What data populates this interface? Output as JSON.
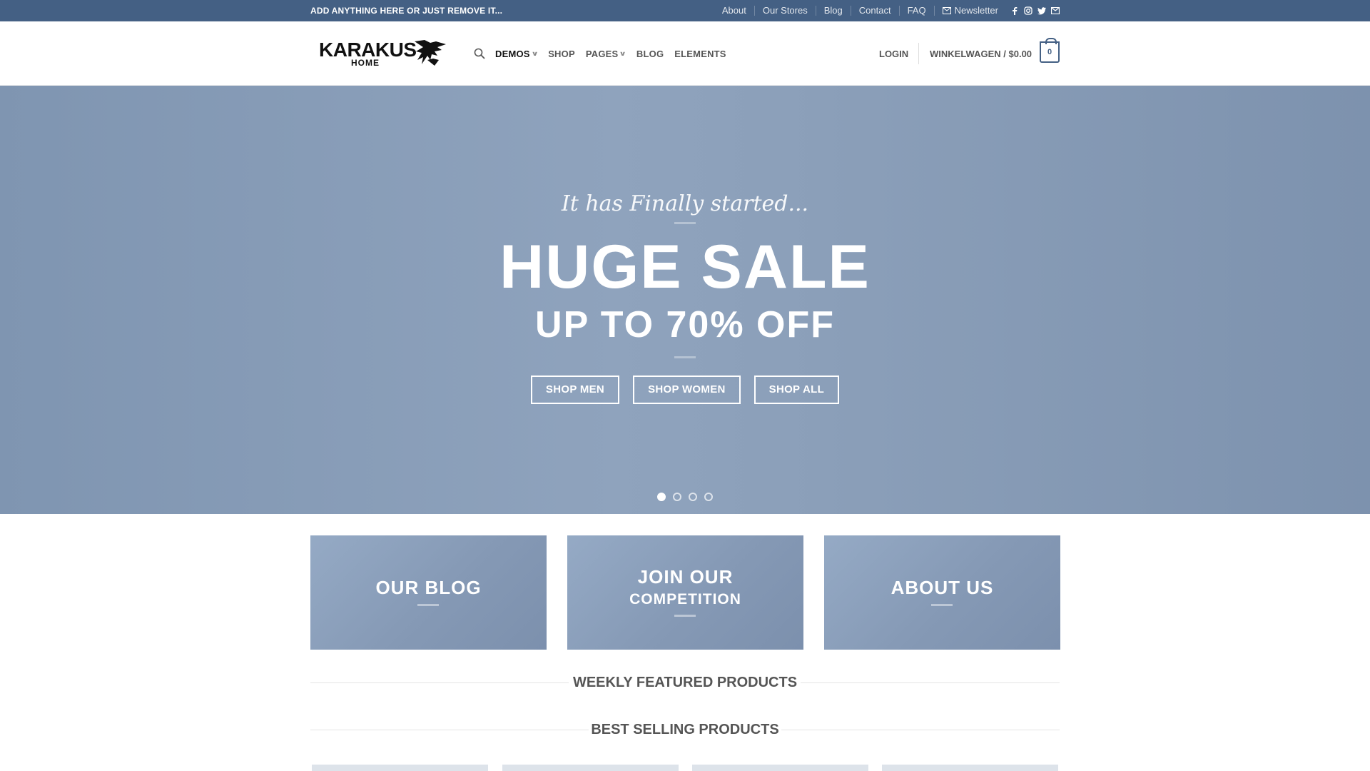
{
  "topbar": {
    "notice": "ADD ANYTHING HERE OR JUST REMOVE IT...",
    "links": [
      "About",
      "Our Stores",
      "Blog",
      "Contact",
      "FAQ"
    ],
    "newsletter": "Newsletter",
    "social_icons": [
      "facebook-icon",
      "instagram-icon",
      "twitter-icon",
      "email-icon"
    ],
    "background": "#446084"
  },
  "header": {
    "logo_word": "KARAKUS",
    "logo_sub": "HOME",
    "nav": [
      {
        "label": "DEMOS",
        "dropdown": true
      },
      {
        "label": "SHOP",
        "dropdown": false
      },
      {
        "label": "PAGES",
        "dropdown": true
      },
      {
        "label": "BLOG",
        "dropdown": false
      },
      {
        "label": "ELEMENTS",
        "dropdown": false
      }
    ],
    "login": "LOGIN",
    "cart_label": "WINKELWAGEN / $0.00",
    "cart_count": "0"
  },
  "hero": {
    "tagline": "It has Finally started...",
    "title": "HUGE SALE",
    "subtitle": "UP TO 70% OFF",
    "buttons": [
      "SHOP MEN",
      "SHOP WOMEN",
      "SHOP ALL"
    ],
    "slides": 4,
    "active_slide": 1
  },
  "promo_boxes": [
    {
      "line1": "OUR BLOG",
      "line2": ""
    },
    {
      "line1": "JOIN OUR",
      "line2": "COMPETITION"
    },
    {
      "line1": "ABOUT US",
      "line2": ""
    }
  ],
  "sections": {
    "featured": "WEEKLY FEATURED PRODUCTS",
    "best_selling": "BEST SELLING PRODUCTS"
  },
  "colors": {
    "primary": "#446084",
    "hero_bg": "#8a9fba"
  }
}
